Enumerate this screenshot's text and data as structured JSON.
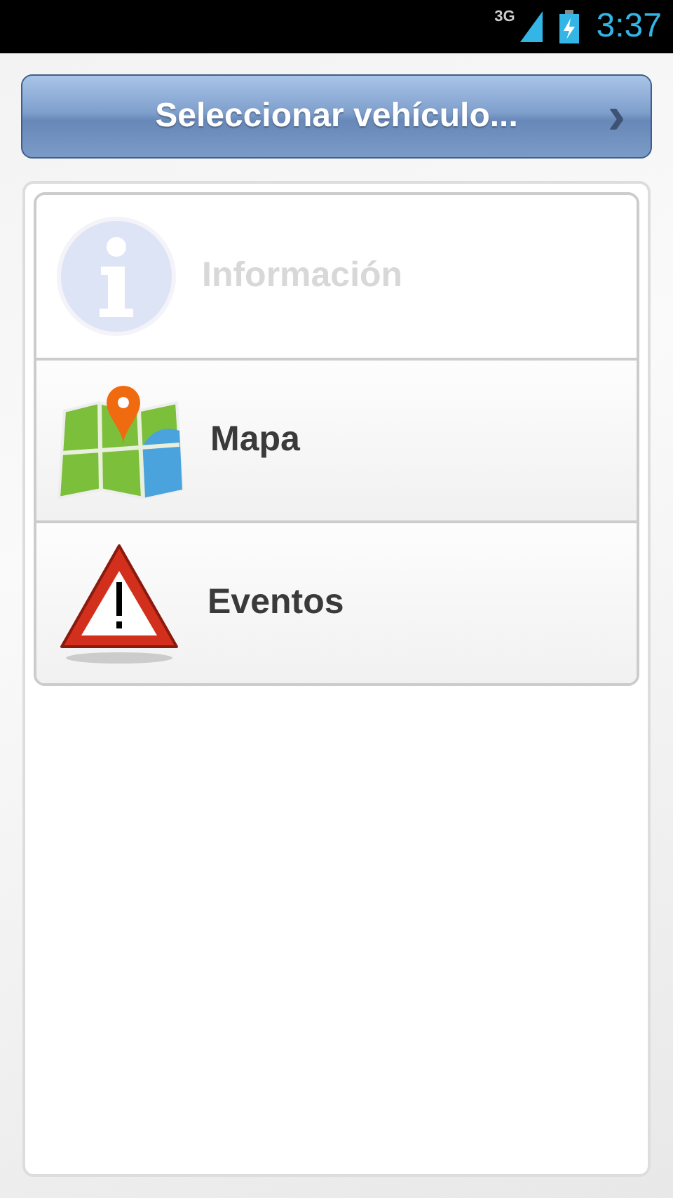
{
  "status_bar": {
    "network": "3G",
    "time": "3:37"
  },
  "select_button": {
    "label": "Seleccionar vehículo...",
    "chevron": "›"
  },
  "menu": [
    {
      "kind": "info",
      "label": "Información",
      "disabled": true
    },
    {
      "kind": "map",
      "label": "Mapa",
      "disabled": false
    },
    {
      "kind": "warning",
      "label": "Eventos",
      "disabled": false
    }
  ]
}
